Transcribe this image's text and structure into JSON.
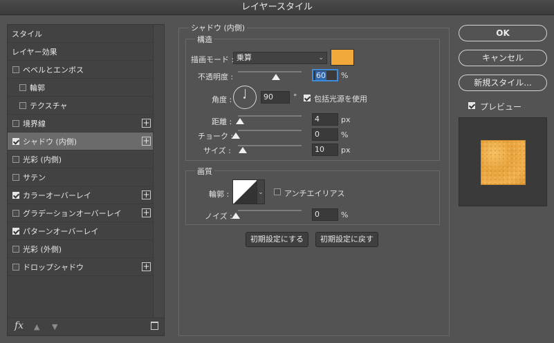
{
  "window": {
    "title": "レイヤースタイル"
  },
  "styles": {
    "items": [
      {
        "label": "スタイル",
        "checkbox": false,
        "checked": false,
        "plus": false,
        "indent": false,
        "selected": false
      },
      {
        "label": "レイヤー効果",
        "checkbox": false,
        "checked": false,
        "plus": false,
        "indent": false,
        "selected": false
      },
      {
        "label": "ベベルとエンボス",
        "checkbox": true,
        "checked": false,
        "plus": false,
        "indent": false,
        "selected": false
      },
      {
        "label": "輪郭",
        "checkbox": true,
        "checked": false,
        "plus": false,
        "indent": true,
        "selected": false
      },
      {
        "label": "テクスチャ",
        "checkbox": true,
        "checked": false,
        "plus": false,
        "indent": true,
        "selected": false
      },
      {
        "label": "境界線",
        "checkbox": true,
        "checked": false,
        "plus": true,
        "indent": false,
        "selected": false
      },
      {
        "label": "シャドウ (内側)",
        "checkbox": true,
        "checked": true,
        "plus": true,
        "indent": false,
        "selected": true
      },
      {
        "label": "光彩 (内側)",
        "checkbox": true,
        "checked": false,
        "plus": false,
        "indent": false,
        "selected": false
      },
      {
        "label": "サテン",
        "checkbox": true,
        "checked": false,
        "plus": false,
        "indent": false,
        "selected": false
      },
      {
        "label": "カラーオーバーレイ",
        "checkbox": true,
        "checked": true,
        "plus": true,
        "indent": false,
        "selected": false
      },
      {
        "label": "グラデーションオーバーレイ",
        "checkbox": true,
        "checked": false,
        "plus": true,
        "indent": false,
        "selected": false
      },
      {
        "label": "パターンオーバーレイ",
        "checkbox": true,
        "checked": true,
        "plus": false,
        "indent": false,
        "selected": false
      },
      {
        "label": "光彩 (外側)",
        "checkbox": true,
        "checked": false,
        "plus": false,
        "indent": false,
        "selected": false
      },
      {
        "label": "ドロップシャドウ",
        "checkbox": true,
        "checked": false,
        "plus": true,
        "indent": false,
        "selected": false
      }
    ],
    "footer_fx": "fx"
  },
  "panel": {
    "title": "シャドウ (内側)",
    "structure": {
      "legend": "構造",
      "blend_mode_label": "描画モード :",
      "blend_mode_value": "乗算",
      "shadow_color": "#f0a93a",
      "opacity_label": "不透明度 :",
      "opacity_value": "60",
      "opacity_unit": "%",
      "opacity_fraction": 0.6,
      "angle_label": "角度 :",
      "angle_value": "90",
      "angle_unit": "°",
      "global_light_label": "包括光源を使用",
      "global_light_checked": true,
      "distance_label": "距離 :",
      "distance_value": "4",
      "distance_unit": "px",
      "choke_label": "チョーク :",
      "choke_value": "0",
      "choke_unit": "%",
      "size_label": "サイズ :",
      "size_value": "10",
      "size_unit": "px"
    },
    "quality": {
      "legend": "画質",
      "contour_label": "輪郭 :",
      "antialias_label": "アンチエイリアス",
      "antialias_checked": false,
      "noise_label": "ノイズ :",
      "noise_value": "0",
      "noise_unit": "%"
    },
    "make_default_label": "初期設定にする",
    "reset_default_label": "初期設定に戻す"
  },
  "actions": {
    "ok_label": "OK",
    "cancel_label": "キャンセル",
    "new_style_label": "新規スタイル...",
    "preview_label": "プレビュー",
    "preview_checked": true
  }
}
